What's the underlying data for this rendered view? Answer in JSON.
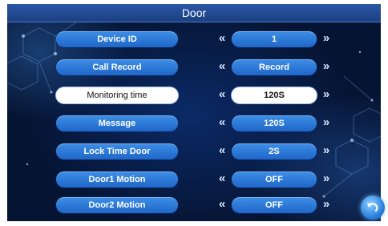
{
  "title": "Door",
  "rows": [
    {
      "label": "Device ID",
      "value": "1",
      "selected": false
    },
    {
      "label": "Call Record",
      "value": "Record",
      "selected": false
    },
    {
      "label": "Monitoring time",
      "value": "120S",
      "selected": true
    },
    {
      "label": "Message",
      "value": "120S",
      "selected": false
    },
    {
      "label": "Lock Time Door",
      "value": "2S",
      "selected": false
    },
    {
      "label": "Door1 Motion",
      "value": "OFF",
      "selected": false
    },
    {
      "label": "Door2 Motion",
      "value": "OFF",
      "selected": false
    }
  ],
  "icons": {
    "decrease": "double-chevron-left-icon",
    "increase": "double-chevron-right-icon",
    "back": "back-arrow-icon"
  },
  "colors": {
    "accent": "#2f7ad8",
    "title_bar": "#2a58a6",
    "background": "#061433",
    "selected_bg": "#ffffff"
  }
}
